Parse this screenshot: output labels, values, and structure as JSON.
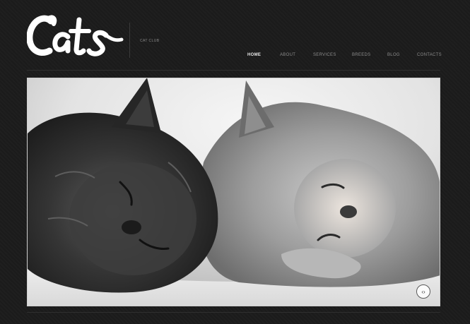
{
  "header": {
    "logo_text": "Cats",
    "tagline": "Cat Club"
  },
  "nav": {
    "items": [
      {
        "label": "Home",
        "active": true
      },
      {
        "label": "About",
        "active": false
      },
      {
        "label": "Services",
        "active": false
      },
      {
        "label": "Breeds",
        "active": false
      },
      {
        "label": "Blog",
        "active": false
      },
      {
        "label": "Contacts",
        "active": false
      }
    ]
  },
  "slider": {
    "control_glyph": "‹›"
  },
  "colors": {
    "background": "#1c1c1c",
    "active_nav": "#e8e8e8",
    "nav": "#8c8c8c",
    "accent": "#5fa8c9"
  }
}
